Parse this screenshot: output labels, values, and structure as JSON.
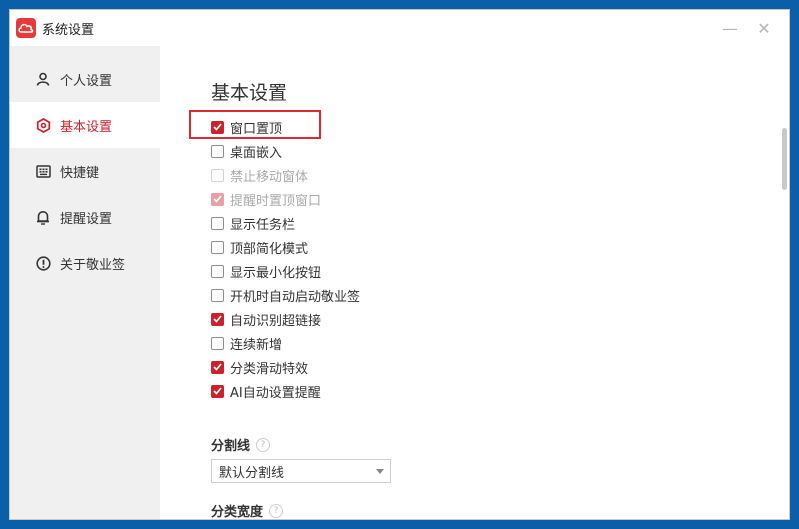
{
  "window": {
    "title": "系统设置",
    "min_symbol": "—",
    "close_symbol": "✕"
  },
  "sidebar": {
    "items": [
      {
        "label": "个人设置",
        "icon": "user-icon",
        "active": false
      },
      {
        "label": "基本设置",
        "icon": "settings-hex-icon",
        "active": true
      },
      {
        "label": "快捷键",
        "icon": "keyboard-icon",
        "active": false
      },
      {
        "label": "提醒设置",
        "icon": "bell-icon",
        "active": false
      },
      {
        "label": "关于敬业签",
        "icon": "info-icon",
        "active": false
      }
    ]
  },
  "main": {
    "title": "基本设置",
    "options": [
      {
        "label": "窗口置顶",
        "checked": true,
        "disabled": false
      },
      {
        "label": "桌面嵌入",
        "checked": false,
        "disabled": false
      },
      {
        "label": "禁止移动窗体",
        "checked": false,
        "disabled": true
      },
      {
        "label": "提醒时置顶窗口",
        "checked": true,
        "disabled": true
      },
      {
        "label": "显示任务栏",
        "checked": false,
        "disabled": false
      },
      {
        "label": "顶部简化模式",
        "checked": false,
        "disabled": false
      },
      {
        "label": "显示最小化按钮",
        "checked": false,
        "disabled": false
      },
      {
        "label": "开机时自动启动敬业签",
        "checked": false,
        "disabled": false
      },
      {
        "label": "自动识别超链接",
        "checked": true,
        "disabled": false
      },
      {
        "label": "连续新增",
        "checked": false,
        "disabled": false
      },
      {
        "label": "分类滑动特效",
        "checked": true,
        "disabled": false
      },
      {
        "label": "AI自动设置提醒",
        "checked": true,
        "disabled": false
      }
    ],
    "divider": {
      "label": "分割线",
      "help": "?",
      "selected": "默认分割线"
    },
    "category_width": {
      "label": "分类宽度",
      "help": "?"
    }
  },
  "colors": {
    "accent": "#c9222b",
    "highlight_border": "#e0292f",
    "sidebar_bg": "#f0f0f0",
    "desktop_bg": "#0b5ea8"
  }
}
